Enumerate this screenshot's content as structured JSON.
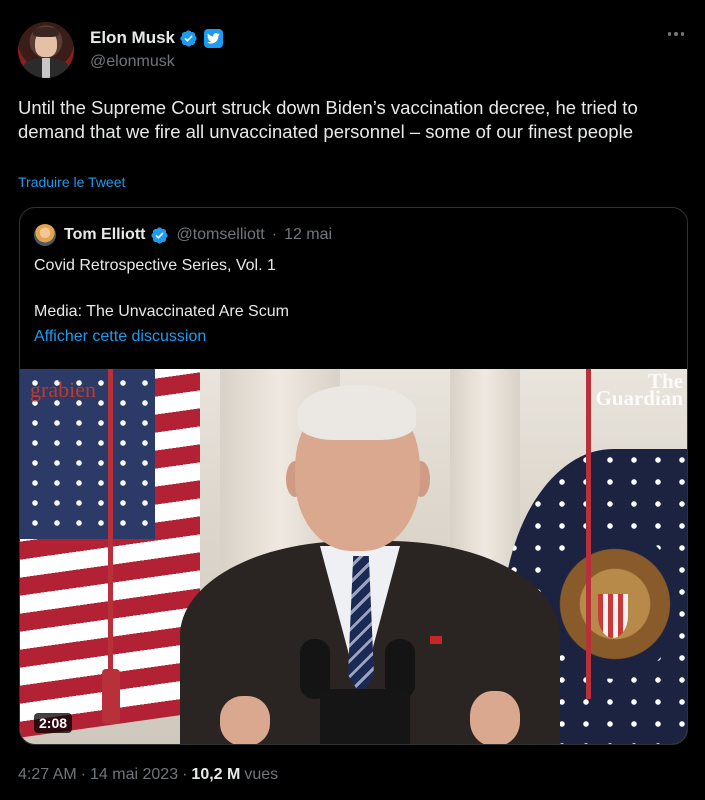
{
  "author": {
    "name": "Elon Musk",
    "handle": "@elonmusk",
    "avatar_icon": "profile-photo",
    "verified_icon": "verified-badge-icon",
    "affiliate_icon": "twitter-bird-icon"
  },
  "tweet": {
    "text": "Until the Supreme Court struck down Biden’s vaccination decree, he tried to demand that we fire all unvaccinated personnel – some of our finest people",
    "translate_label": "Traduire le Tweet"
  },
  "quoted": {
    "name": "Tom Elliott",
    "handle": "@tomselliott",
    "separator": "·",
    "date": "12 mai",
    "line1": "Covid Retrospective Series, Vol. 1",
    "line2": "Media: The Unvaccinated Are Scum",
    "thread_link": "Afficher cette discussion",
    "video": {
      "watermark_left": "grabien",
      "watermark_right_line1": "The",
      "watermark_right_line2": "Guardian",
      "duration": "2:08"
    }
  },
  "meta": {
    "time": "4:27 AM",
    "sep1": "·",
    "date": "14 mai 2023",
    "sep2": "·",
    "views_count": "10,2 M",
    "views_label": "vues"
  },
  "colors": {
    "background": "#000000",
    "text": "#e7e9ea",
    "muted": "#71767b",
    "link": "#1d9bf0",
    "border": "#2f3336"
  }
}
